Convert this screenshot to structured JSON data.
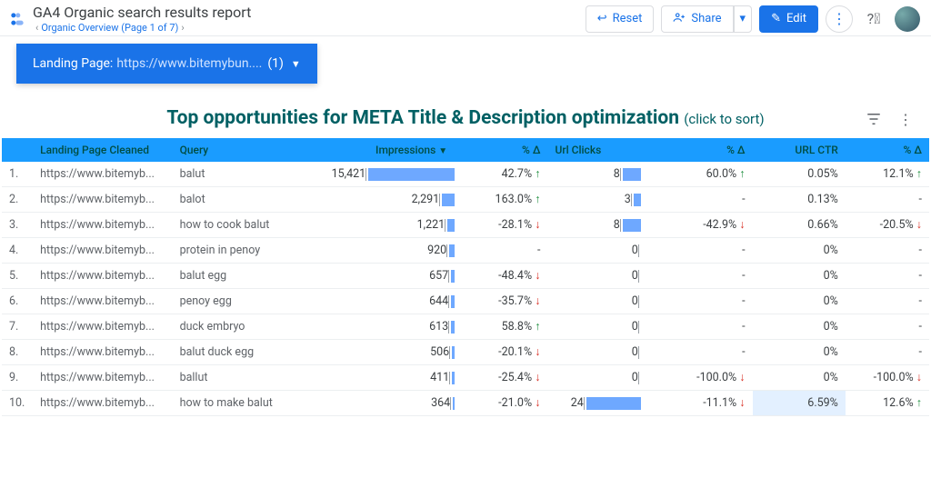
{
  "header": {
    "title": "GA4 Organic search results report",
    "breadcrumb": "Organic Overview (Page 1 of 7)",
    "reset": "Reset",
    "share": "Share",
    "edit": "Edit"
  },
  "filter": {
    "fieldLabel": "Landing Page",
    "valueText": "https://www.bitemybun....",
    "countText": "(1)"
  },
  "section": {
    "title": "Top opportunities for META Title & Description optimization",
    "sub": "(click to sort)"
  },
  "columns": {
    "page": "Landing Page Cleaned",
    "query": "Query",
    "impressions": "Impressions",
    "delta1": "% Δ",
    "clicks": "Url Clicks",
    "delta2": "% Δ",
    "ctr": "URL CTR",
    "delta3": "% Δ"
  },
  "maxImpr": 15421,
  "maxClicks": 24,
  "rows": [
    {
      "n": "1.",
      "url": "https://www.bitemyb...",
      "query": "balut",
      "impr": "15,421",
      "imprN": 15421,
      "d1": "42.7%",
      "d1dir": "up",
      "clicks": "8",
      "clicksN": 8,
      "d2": "60.0%",
      "d2dir": "up",
      "ctr": "0.05%",
      "d3": "12.1%",
      "d3dir": "up",
      "hl": false
    },
    {
      "n": "2.",
      "url": "https://www.bitemyb...",
      "query": "balot",
      "impr": "2,291",
      "imprN": 2291,
      "d1": "163.0%",
      "d1dir": "up",
      "clicks": "3",
      "clicksN": 3,
      "d2": "-",
      "d2dir": "",
      "ctr": "0.13%",
      "d3": "-",
      "d3dir": "",
      "hl": false
    },
    {
      "n": "3.",
      "url": "https://www.bitemyb...",
      "query": "how to cook balut",
      "impr": "1,221",
      "imprN": 1221,
      "d1": "-28.1%",
      "d1dir": "down",
      "clicks": "8",
      "clicksN": 8,
      "d2": "-42.9%",
      "d2dir": "down",
      "ctr": "0.66%",
      "d3": "-20.5%",
      "d3dir": "down",
      "hl": false
    },
    {
      "n": "4.",
      "url": "https://www.bitemyb...",
      "query": "protein in penoy",
      "impr": "920",
      "imprN": 920,
      "d1": "-",
      "d1dir": "",
      "clicks": "0",
      "clicksN": 0,
      "d2": "-",
      "d2dir": "",
      "ctr": "0%",
      "d3": "-",
      "d3dir": "",
      "hl": false
    },
    {
      "n": "5.",
      "url": "https://www.bitemyb...",
      "query": "balut egg",
      "impr": "657",
      "imprN": 657,
      "d1": "-48.4%",
      "d1dir": "down",
      "clicks": "0",
      "clicksN": 0,
      "d2": "-",
      "d2dir": "",
      "ctr": "0%",
      "d3": "-",
      "d3dir": "",
      "hl": false
    },
    {
      "n": "6.",
      "url": "https://www.bitemyb...",
      "query": "penoy egg",
      "impr": "644",
      "imprN": 644,
      "d1": "-35.7%",
      "d1dir": "down",
      "clicks": "0",
      "clicksN": 0,
      "d2": "-",
      "d2dir": "",
      "ctr": "0%",
      "d3": "-",
      "d3dir": "",
      "hl": false
    },
    {
      "n": "7.",
      "url": "https://www.bitemyb...",
      "query": "duck embryo",
      "impr": "613",
      "imprN": 613,
      "d1": "58.8%",
      "d1dir": "up",
      "clicks": "0",
      "clicksN": 0,
      "d2": "-",
      "d2dir": "",
      "ctr": "0%",
      "d3": "-",
      "d3dir": "",
      "hl": false
    },
    {
      "n": "8.",
      "url": "https://www.bitemyb...",
      "query": "balut duck egg",
      "impr": "506",
      "imprN": 506,
      "d1": "-20.1%",
      "d1dir": "down",
      "clicks": "0",
      "clicksN": 0,
      "d2": "-",
      "d2dir": "",
      "ctr": "0%",
      "d3": "-",
      "d3dir": "",
      "hl": false
    },
    {
      "n": "9.",
      "url": "https://www.bitemyb...",
      "query": "ballut",
      "impr": "411",
      "imprN": 411,
      "d1": "-25.4%",
      "d1dir": "down",
      "clicks": "0",
      "clicksN": 0,
      "d2": "-100.0%",
      "d2dir": "down",
      "ctr": "0%",
      "d3": "-100.0%",
      "d3dir": "down",
      "hl": false
    },
    {
      "n": "10.",
      "url": "https://www.bitemyb...",
      "query": "how to make balut",
      "impr": "364",
      "imprN": 364,
      "d1": "-21.0%",
      "d1dir": "down",
      "clicks": "24",
      "clicksN": 24,
      "d2": "-11.1%",
      "d2dir": "down",
      "ctr": "6.59%",
      "d3": "12.6%",
      "d3dir": "up",
      "hl": true
    }
  ]
}
